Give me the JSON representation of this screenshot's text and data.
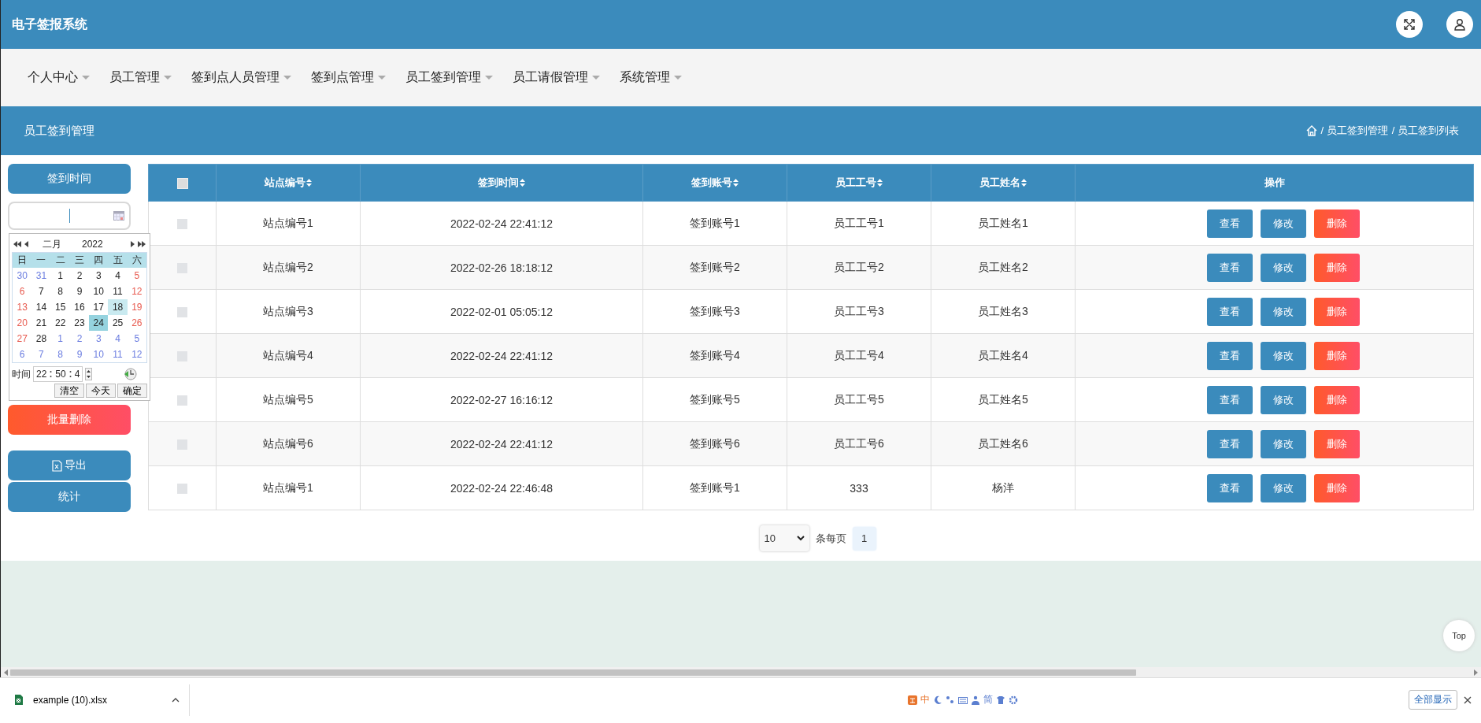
{
  "app": {
    "title": "电子签报系统"
  },
  "nav": {
    "items": [
      {
        "label": "个人中心"
      },
      {
        "label": "员工管理"
      },
      {
        "label": "签到点人员管理"
      },
      {
        "label": "签到点管理"
      },
      {
        "label": "员工签到管理"
      },
      {
        "label": "员工请假管理"
      },
      {
        "label": "系统管理"
      }
    ]
  },
  "page_header": {
    "title": "员工签到管理",
    "breadcrumb": [
      "/ 员工签到管理",
      "/ 员工签到列表"
    ]
  },
  "sidebar": {
    "filter_label": "签到时间",
    "batch_delete": "批量删除",
    "export": "导出",
    "stats": "统计"
  },
  "calendar": {
    "month": "二月",
    "year": "2022",
    "weekdays": [
      "日",
      "一",
      "二",
      "三",
      "四",
      "五",
      "六"
    ],
    "days": [
      {
        "d": "30",
        "kind": "prev",
        "selected": false,
        "hovered": false
      },
      {
        "d": "31",
        "kind": "prev",
        "selected": false,
        "hovered": false
      },
      {
        "d": "1",
        "kind": "cur",
        "selected": false,
        "hovered": false
      },
      {
        "d": "2",
        "kind": "cur",
        "selected": false,
        "hovered": false
      },
      {
        "d": "3",
        "kind": "cur",
        "selected": false,
        "hovered": false
      },
      {
        "d": "4",
        "kind": "cur",
        "selected": false,
        "hovered": false
      },
      {
        "d": "5",
        "kind": "cur",
        "selected": false,
        "hovered": false
      },
      {
        "d": "6",
        "kind": "cur",
        "selected": false,
        "hovered": false
      },
      {
        "d": "7",
        "kind": "cur",
        "selected": false,
        "hovered": false
      },
      {
        "d": "8",
        "kind": "cur",
        "selected": false,
        "hovered": false
      },
      {
        "d": "9",
        "kind": "cur",
        "selected": false,
        "hovered": false
      },
      {
        "d": "10",
        "kind": "cur",
        "selected": false,
        "hovered": false
      },
      {
        "d": "11",
        "kind": "cur",
        "selected": false,
        "hovered": false
      },
      {
        "d": "12",
        "kind": "cur",
        "selected": false,
        "hovered": false
      },
      {
        "d": "13",
        "kind": "cur",
        "selected": false,
        "hovered": false
      },
      {
        "d": "14",
        "kind": "cur",
        "selected": false,
        "hovered": false
      },
      {
        "d": "15",
        "kind": "cur",
        "selected": false,
        "hovered": false
      },
      {
        "d": "16",
        "kind": "cur",
        "selected": false,
        "hovered": false
      },
      {
        "d": "17",
        "kind": "cur",
        "selected": false,
        "hovered": false
      },
      {
        "d": "18",
        "kind": "cur",
        "selected": false,
        "hovered": true
      },
      {
        "d": "19",
        "kind": "cur",
        "selected": false,
        "hovered": false
      },
      {
        "d": "20",
        "kind": "cur",
        "selected": false,
        "hovered": false
      },
      {
        "d": "21",
        "kind": "cur",
        "selected": false,
        "hovered": false
      },
      {
        "d": "22",
        "kind": "cur",
        "selected": false,
        "hovered": false
      },
      {
        "d": "23",
        "kind": "cur",
        "selected": false,
        "hovered": false
      },
      {
        "d": "24",
        "kind": "cur",
        "selected": true,
        "hovered": false
      },
      {
        "d": "25",
        "kind": "cur",
        "selected": false,
        "hovered": false
      },
      {
        "d": "26",
        "kind": "cur",
        "selected": false,
        "hovered": false
      },
      {
        "d": "27",
        "kind": "cur",
        "selected": false,
        "hovered": false
      },
      {
        "d": "28",
        "kind": "cur",
        "selected": false,
        "hovered": false
      },
      {
        "d": "1",
        "kind": "next",
        "selected": false,
        "hovered": false
      },
      {
        "d": "2",
        "kind": "next",
        "selected": false,
        "hovered": false
      },
      {
        "d": "3",
        "kind": "next",
        "selected": false,
        "hovered": false
      },
      {
        "d": "4",
        "kind": "next",
        "selected": false,
        "hovered": false
      },
      {
        "d": "5",
        "kind": "next",
        "selected": false,
        "hovered": false
      },
      {
        "d": "6",
        "kind": "next",
        "selected": false,
        "hovered": false
      },
      {
        "d": "7",
        "kind": "next",
        "selected": false,
        "hovered": false
      },
      {
        "d": "8",
        "kind": "next",
        "selected": false,
        "hovered": false
      },
      {
        "d": "9",
        "kind": "next",
        "selected": false,
        "hovered": false
      },
      {
        "d": "10",
        "kind": "next",
        "selected": false,
        "hovered": false
      },
      {
        "d": "11",
        "kind": "next",
        "selected": false,
        "hovered": false
      },
      {
        "d": "12",
        "kind": "next",
        "selected": false,
        "hovered": false
      }
    ],
    "time_label": "时间",
    "hour": "22",
    "minute": "50",
    "second": "4",
    "buttons": [
      "清空",
      "今天",
      "确定"
    ]
  },
  "table": {
    "select_all_checked": false,
    "columns": [
      {
        "label": "站点编号",
        "sortable": true
      },
      {
        "label": "签到时间",
        "sortable": true
      },
      {
        "label": "签到账号",
        "sortable": true
      },
      {
        "label": "员工工号",
        "sortable": true
      },
      {
        "label": "员工姓名",
        "sortable": true
      },
      {
        "label": "操作",
        "sortable": false
      }
    ],
    "rows": [
      {
        "checked": false,
        "cells": [
          "站点编号1",
          "2022-02-24 22:41:12",
          "签到账号1",
          "员工工号1",
          "员工姓名1"
        ],
        "actions": [
          "查看",
          "修改",
          "删除"
        ]
      },
      {
        "checked": false,
        "cells": [
          "站点编号2",
          "2022-02-26 18:18:12",
          "签到账号2",
          "员工工号2",
          "员工姓名2"
        ],
        "actions": [
          "查看",
          "修改",
          "删除"
        ]
      },
      {
        "checked": false,
        "cells": [
          "站点编号3",
          "2022-02-01 05:05:12",
          "签到账号3",
          "员工工号3",
          "员工姓名3"
        ],
        "actions": [
          "查看",
          "修改",
          "删除"
        ]
      },
      {
        "checked": false,
        "cells": [
          "站点编号4",
          "2022-02-24 22:41:12",
          "签到账号4",
          "员工工号4",
          "员工姓名4"
        ],
        "actions": [
          "查看",
          "修改",
          "删除"
        ]
      },
      {
        "checked": false,
        "cells": [
          "站点编号5",
          "2022-02-27 16:16:12",
          "签到账号5",
          "员工工号5",
          "员工姓名5"
        ],
        "actions": [
          "查看",
          "修改",
          "删除"
        ]
      },
      {
        "checked": false,
        "cells": [
          "站点编号6",
          "2022-02-24 22:41:12",
          "签到账号6",
          "员工工号6",
          "员工姓名6"
        ],
        "actions": [
          "查看",
          "修改",
          "删除"
        ]
      },
      {
        "checked": false,
        "cells": [
          "站点编号1",
          "2022-02-24 22:46:48",
          "签到账号1",
          "333",
          "杨洋"
        ],
        "actions": [
          "查看",
          "修改",
          "删除"
        ]
      }
    ]
  },
  "pager": {
    "page_size": "10",
    "per_page_label": "条每页",
    "pages": [
      {
        "label": "1",
        "selected": true
      }
    ]
  },
  "top_button": "Top",
  "download_bar": {
    "file": "example (10).xlsx",
    "show_all": "全部显示"
  },
  "ime_toolbar": {
    "labels": [
      "中",
      "简"
    ]
  }
}
